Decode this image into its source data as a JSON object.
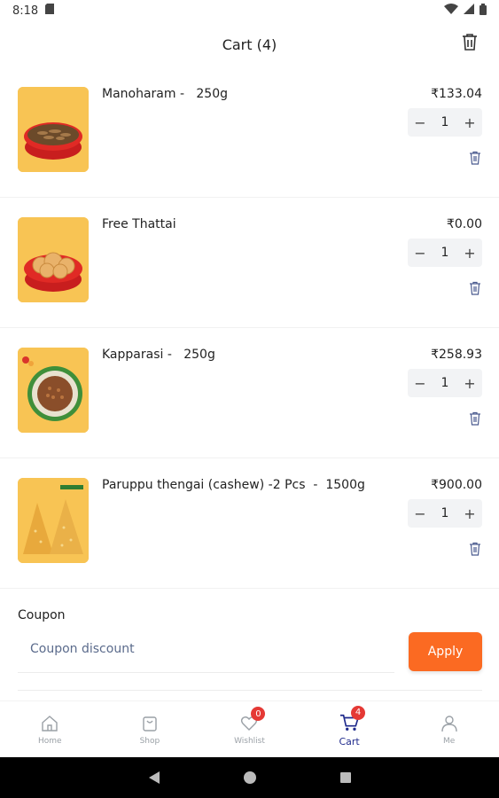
{
  "status": {
    "time": "8:18"
  },
  "header": {
    "title": "Cart (4)"
  },
  "items": [
    {
      "name": "Manoharam -   250g",
      "price": "₹133.04",
      "qty": "1"
    },
    {
      "name": "Free Thattai",
      "price": "₹0.00",
      "qty": "1"
    },
    {
      "name": "Kapparasi -   250g",
      "price": "₹258.93",
      "qty": "1"
    },
    {
      "name": "Paruppu thengai (cashew) -2 Pcs  -  1500g",
      "price": "₹900.00",
      "qty": "1"
    }
  ],
  "coupon": {
    "label": "Coupon",
    "placeholder": "Coupon discount",
    "apply": "Apply"
  },
  "nav": [
    {
      "label": "Home",
      "icon": "home-icon"
    },
    {
      "label": "Shop",
      "icon": "bag-icon"
    },
    {
      "label": "Wishlist",
      "icon": "heart-icon",
      "badge": "0"
    },
    {
      "label": "Cart",
      "icon": "cart-icon",
      "badge": "4"
    },
    {
      "label": "Me",
      "icon": "person-icon"
    }
  ],
  "colors": {
    "accent": "#fb6a22",
    "active_nav": "#1f2a8c",
    "badge": "#e53935"
  }
}
